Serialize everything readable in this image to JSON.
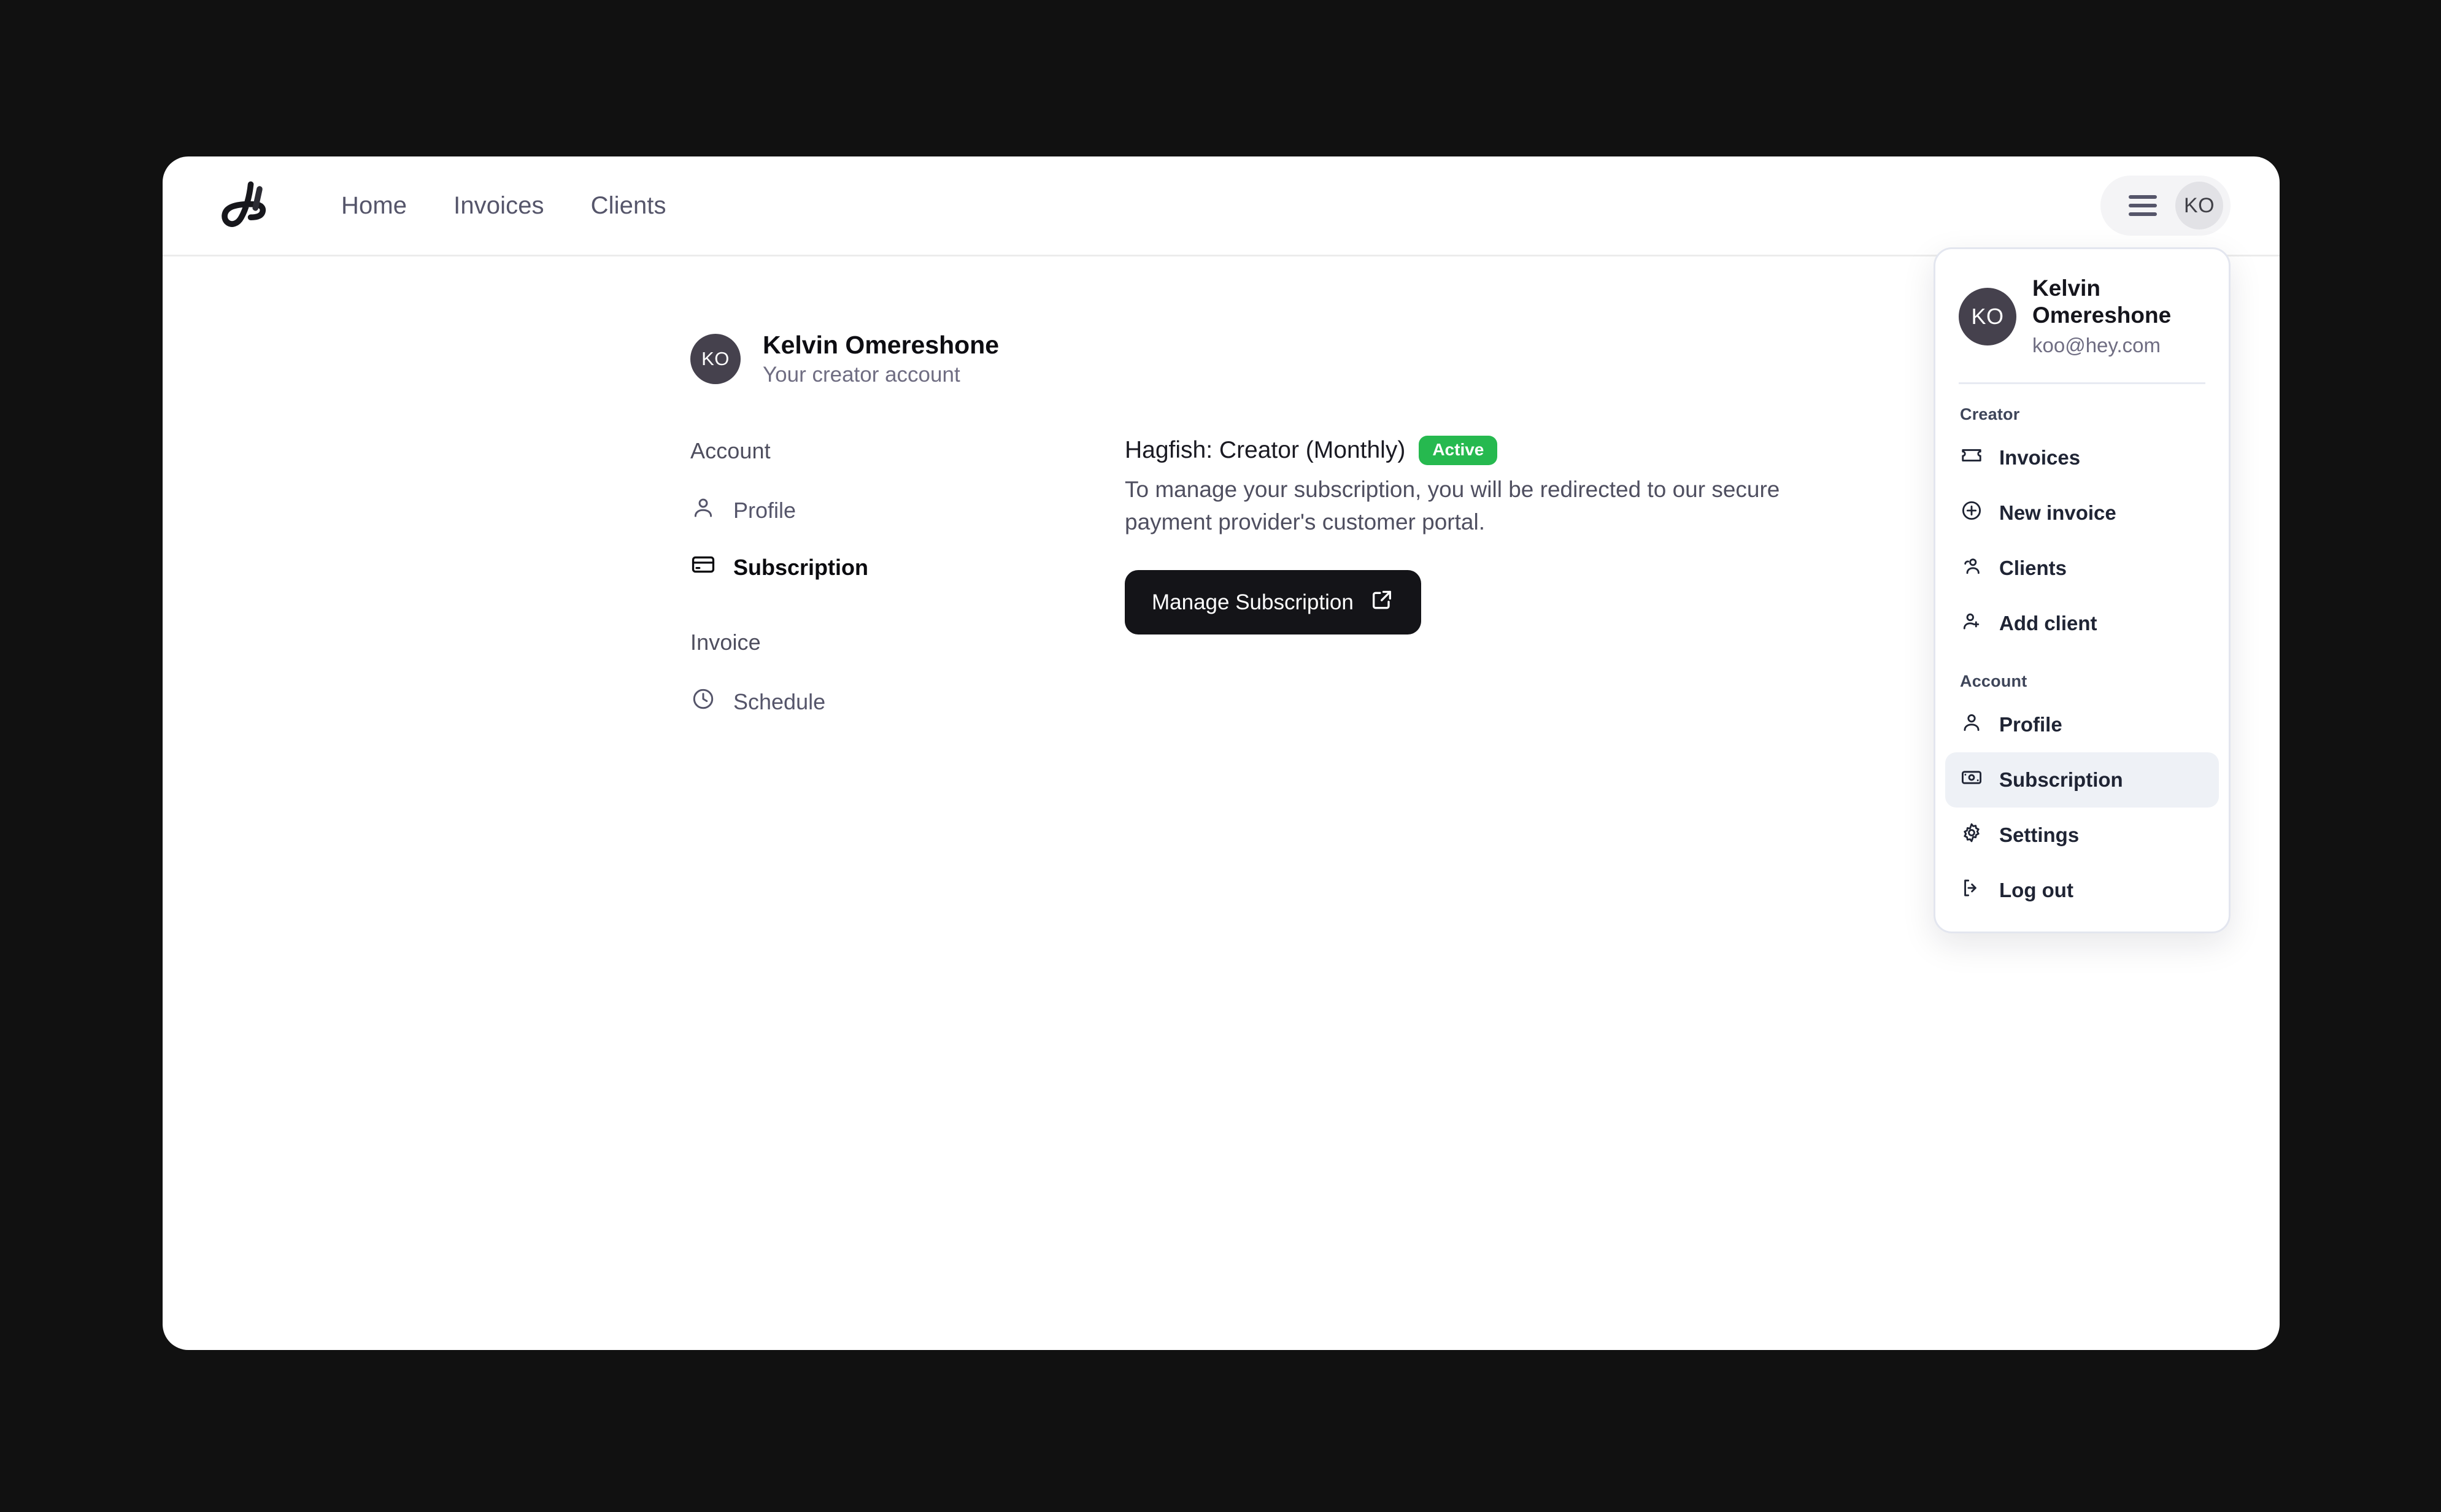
{
  "navbar": {
    "logo_alt": "Hagfish logo",
    "links": [
      {
        "label": "Home"
      },
      {
        "label": "Invoices"
      },
      {
        "label": "Clients"
      }
    ],
    "user_pill": {
      "initials": "KO"
    }
  },
  "account_header": {
    "initials": "KO",
    "name": "Kelvin Omereshone",
    "subtitle": "Your creator account"
  },
  "settings_nav": {
    "groups": [
      {
        "label": "Account",
        "items": [
          {
            "label": "Profile",
            "icon": "user-icon",
            "active": false
          },
          {
            "label": "Subscription",
            "icon": "credit-card-icon",
            "active": true
          }
        ]
      },
      {
        "label": "Invoice",
        "items": [
          {
            "label": "Schedule",
            "icon": "clock-icon",
            "active": false
          }
        ]
      }
    ]
  },
  "panel": {
    "plan_title": "Hagfish: Creator (Monthly)",
    "status_badge": "Active",
    "status_color": "#26b94f",
    "description": "To manage your subscription, you will be redirected to our secure payment provider's customer portal.",
    "manage_button": "Manage Subscription"
  },
  "dropdown": {
    "user": {
      "initials": "KO",
      "name": "Kelvin Omereshone",
      "email": "koo@hey.com"
    },
    "sections": [
      {
        "label": "Creator",
        "items": [
          {
            "label": "Invoices",
            "icon": "ticket-icon",
            "selected": false
          },
          {
            "label": "New invoice",
            "icon": "plus-circle-icon",
            "selected": false
          },
          {
            "label": "Clients",
            "icon": "users-icon",
            "selected": false
          },
          {
            "label": "Add client",
            "icon": "user-plus-icon",
            "selected": false
          }
        ]
      },
      {
        "label": "Account",
        "items": [
          {
            "label": "Profile",
            "icon": "user-icon",
            "selected": false
          },
          {
            "label": "Subscription",
            "icon": "banknote-icon",
            "selected": true
          },
          {
            "label": "Settings",
            "icon": "gear-icon",
            "selected": false
          },
          {
            "label": "Log out",
            "icon": "logout-icon",
            "selected": false
          }
        ]
      }
    ]
  }
}
